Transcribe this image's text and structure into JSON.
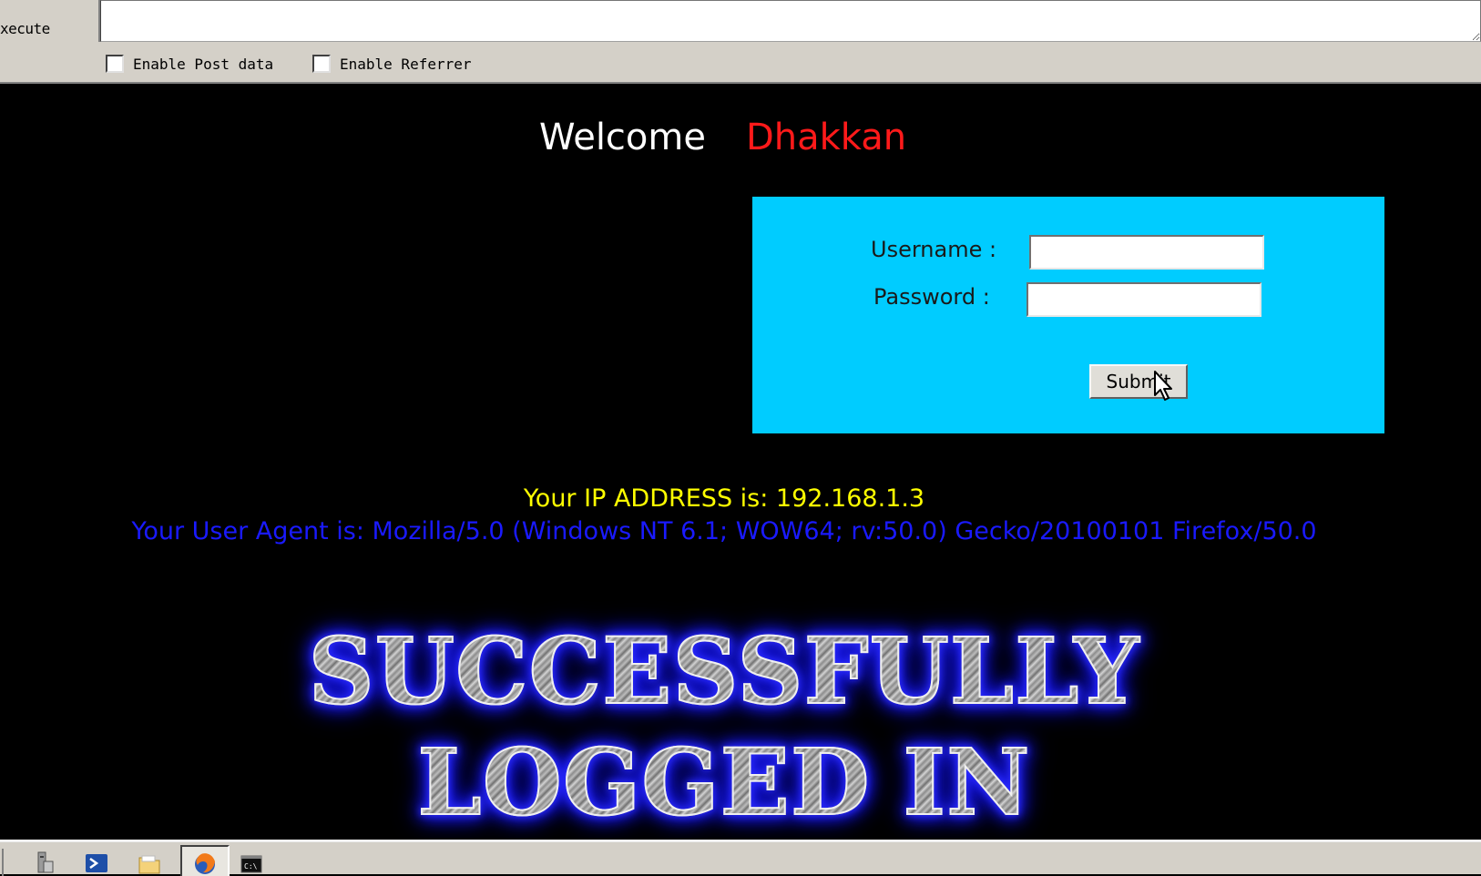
{
  "toolbar": {
    "execute_label": "xecute",
    "url_value": "",
    "options": [
      {
        "label": "Enable Post data",
        "checked": false
      },
      {
        "label": "Enable Referrer",
        "checked": false
      }
    ]
  },
  "page": {
    "welcome_text": "Welcome",
    "user_name": "Dhakkan",
    "login": {
      "username_label": "Username :",
      "password_label": "Password :",
      "username_value": "",
      "password_value": "",
      "submit_label": "Submit"
    },
    "ip_line": "Your IP ADDRESS is: 192.168.1.3",
    "ua_line": "Your User Agent is: Mozilla/5.0 (Windows NT 6.1; WOW64; rv:50.0) Gecko/20100101 Firefox/50.0",
    "banner_line1": "SUCCESSFULLY",
    "banner_line2": "LOGGED IN"
  },
  "colors": {
    "page_background": "#000000",
    "login_box": "#00ccff",
    "user_name": "#ff1a1a",
    "ip_text": "#ffff00",
    "ua_text": "#1a1aff",
    "banner_glow": "#2a2aff"
  },
  "taskbar": {
    "icons": [
      "server-manager-icon",
      "powershell-icon",
      "folder-icon",
      "firefox-icon",
      "cmd-icon"
    ],
    "active_icon": "firefox-icon"
  }
}
